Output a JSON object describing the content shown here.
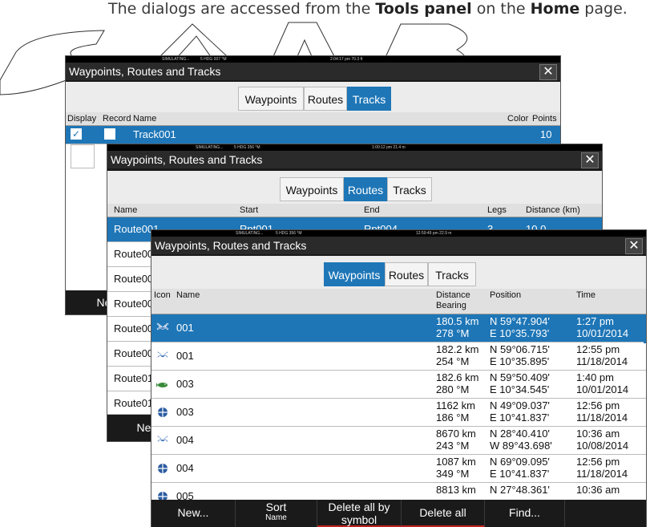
{
  "caption": {
    "pre": "The dialogs are accessed from the ",
    "b1": "Tools panel",
    "mid": " on the ",
    "b2": "Home",
    "post": " page."
  },
  "dialog1": {
    "status": {
      "sim": "SIMULATING...",
      "hdg": "5 HDG 007 °M",
      "time": "2:04:17 pm  70.3 ft"
    },
    "title": "Waypoints, Routes and Tracks",
    "close": "✕",
    "tabs": [
      "Waypoints",
      "Routes",
      "Tracks"
    ],
    "headers": [
      "Display",
      "Record",
      "Name",
      "Color",
      "Points"
    ],
    "row": {
      "name": "Track001",
      "points": "10"
    },
    "foot": [
      "Ne"
    ]
  },
  "dialog2": {
    "status": {
      "sim": "SIMULATING...",
      "hdg": "5 HDG 356 °M",
      "time": "1:00:12 pm  21.4 m"
    },
    "title": "Waypoints, Routes and Tracks",
    "close": "✕",
    "tabs": [
      "Waypoints",
      "Routes",
      "Tracks"
    ],
    "headers": [
      "Name",
      "Start",
      "End",
      "Legs",
      "Distance (km)"
    ],
    "rows": [
      {
        "name": "Route001",
        "start": "Rpt001",
        "end": "Rpt004",
        "legs": "3",
        "dist": "10.0"
      },
      {
        "name": "Route00"
      },
      {
        "name": "Route00"
      },
      {
        "name": "Route00"
      },
      {
        "name": "Route00"
      },
      {
        "name": "Route00"
      },
      {
        "name": "Route01"
      },
      {
        "name": "Route01"
      }
    ],
    "foot": [
      "Ne"
    ]
  },
  "dialog3": {
    "status": {
      "sim": "SIMULATING...",
      "hdg": "5 HDG 356 °M",
      "time": "12:59:49 pm  22.9 m"
    },
    "title": "Waypoints, Routes and Tracks",
    "close": "✕",
    "tabs": [
      "Waypoints",
      "Routes",
      "Tracks"
    ],
    "headers": {
      "icon": "Icon",
      "name": "Name",
      "dist1": "Distance",
      "dist2": "Bearing",
      "pos": "Position",
      "time": "Time"
    },
    "rows": [
      {
        "icon": "cross-icon",
        "name": "001",
        "dist": "180.5 km",
        "bearing": "278 °M",
        "lat": "N  59°47.904'",
        "lon": "E  10°35.793'",
        "t1": "1:27 pm",
        "t2": "10/01/2014"
      },
      {
        "icon": "cross-icon",
        "name": "001",
        "dist": "182.2 km",
        "bearing": "254 °M",
        "lat": "N  59°06.715'",
        "lon": "E  10°35.895'",
        "t1": "12:55 pm",
        "t2": "11/18/2014"
      },
      {
        "icon": "fish-icon",
        "name": "003",
        "dist": "182.6 km",
        "bearing": "280 °M",
        "lat": "N  59°50.409'",
        "lon": "E  10°34.545'",
        "t1": "1:40 pm",
        "t2": "10/01/2014"
      },
      {
        "icon": "crosshair-icon",
        "name": "003",
        "dist": "1162 km",
        "bearing": "186 °M",
        "lat": "N  49°09.037'",
        "lon": "E  10°41.837'",
        "t1": "12:56 pm",
        "t2": "11/18/2014"
      },
      {
        "icon": "cross-icon",
        "name": "004",
        "dist": "8670 km",
        "bearing": "243 °M",
        "lat": "N  28°40.410'",
        "lon": "W  89°43.698'",
        "t1": "10:36 am",
        "t2": "10/08/2014"
      },
      {
        "icon": "crosshair-icon",
        "name": "004",
        "dist": "1087 km",
        "bearing": "349 °M",
        "lat": "N  69°09.095'",
        "lon": "E  10°41.837'",
        "t1": "12:56 pm",
        "t2": "11/18/2014"
      },
      {
        "icon": "crosshair-icon",
        "name": "005",
        "dist": "8813 km",
        "bearing": "",
        "lat": "N  27°48.361'",
        "lon": "",
        "t1": "10:36 am",
        "t2": ""
      }
    ],
    "foot": [
      {
        "l1": "New...",
        "l2": ""
      },
      {
        "l1": "Sort",
        "l2": "Name"
      },
      {
        "l1": "Delete all by",
        "l2": "symbol"
      },
      {
        "l1": "Delete all",
        "l2": ""
      },
      {
        "l1": "Find...",
        "l2": ""
      }
    ]
  },
  "colors": {
    "accent": "#1e76b7",
    "dialog": "#1a1a1a"
  }
}
